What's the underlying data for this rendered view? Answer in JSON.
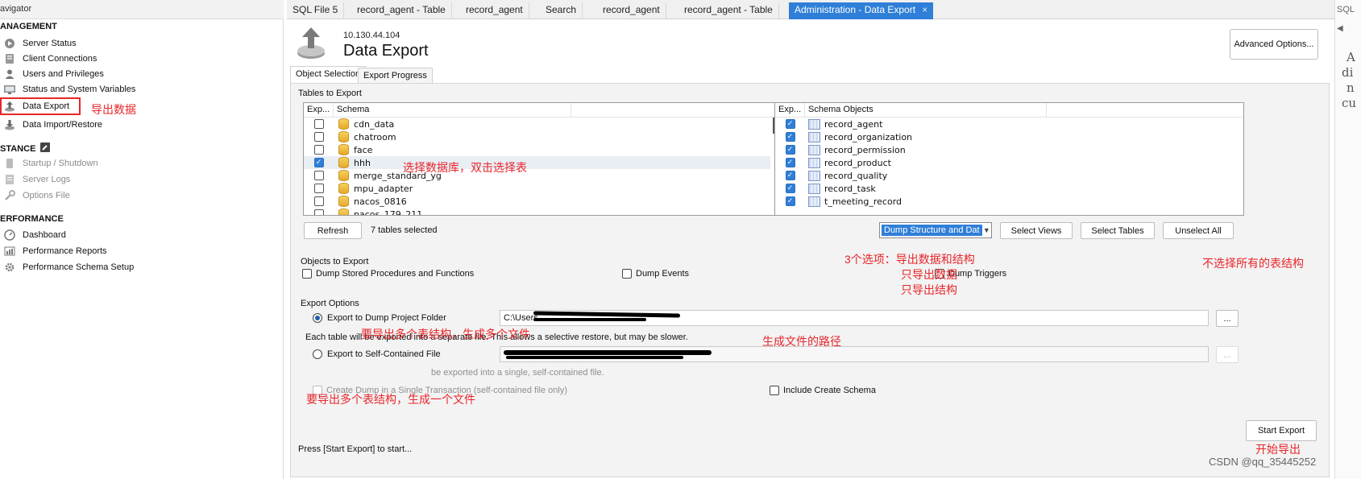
{
  "navigator": {
    "title": "avigator",
    "management": {
      "heading": "ANAGEMENT",
      "items": [
        {
          "label": "Server Status"
        },
        {
          "label": "Client Connections"
        },
        {
          "label": "Users and Privileges"
        },
        {
          "label": "Status and System Variables"
        },
        {
          "label": "Data Export"
        },
        {
          "label": "Data Import/Restore"
        }
      ]
    },
    "instance": {
      "heading": "STANCE",
      "items": [
        {
          "label": "Startup / Shutdown"
        },
        {
          "label": "Server Logs"
        },
        {
          "label": "Options File"
        }
      ]
    },
    "performance": {
      "heading": "ERFORMANCE",
      "items": [
        {
          "label": "Dashboard"
        },
        {
          "label": "Performance Reports"
        },
        {
          "label": "Performance Schema Setup"
        }
      ]
    }
  },
  "tabs": [
    {
      "label": "SQL File 5"
    },
    {
      "label": "record_agent - Table"
    },
    {
      "label": "record_agent"
    },
    {
      "label": "Search"
    },
    {
      "label": "record_agent"
    },
    {
      "label": "record_agent - Table"
    },
    {
      "label": "Administration - Data Export",
      "close": "×"
    }
  ],
  "header": {
    "host": "10.130.44.104",
    "title": "Data Export",
    "advanced_button": "Advanced Options..."
  },
  "subtabs": [
    {
      "label": "Object Selection"
    },
    {
      "label": "Export Progress"
    }
  ],
  "tables_to_export": {
    "group_label": "Tables to Export",
    "schema_list": {
      "col_exp": "Exp...",
      "col_schema": "Schema",
      "rows": [
        {
          "name": "cdn_data",
          "checked": false
        },
        {
          "name": "chatroom",
          "checked": false
        },
        {
          "name": "face",
          "checked": false
        },
        {
          "name": "hhh",
          "checked": true
        },
        {
          "name": "merge_standard_yg",
          "checked": false
        },
        {
          "name": "mpu_adapter",
          "checked": false
        },
        {
          "name": "nacos_0816",
          "checked": false
        },
        {
          "name": "nacos_179_211",
          "checked": false
        }
      ]
    },
    "objects_list": {
      "col_exp": "Exp...",
      "col_objects": "Schema Objects",
      "rows": [
        {
          "name": "record_agent",
          "checked": true
        },
        {
          "name": "record_organization",
          "checked": true
        },
        {
          "name": "record_permission",
          "checked": true
        },
        {
          "name": "record_product",
          "checked": true
        },
        {
          "name": "record_quality",
          "checked": true
        },
        {
          "name": "record_task",
          "checked": true
        },
        {
          "name": "t_meeting_record",
          "checked": true
        }
      ]
    },
    "refresh_button": "Refresh",
    "selected_count": "7 tables selected",
    "dump_mode": "Dump Structure and Dat",
    "select_views_button": "Select Views",
    "select_tables_button": "Select Tables",
    "unselect_all_button": "Unselect All"
  },
  "objects_to_export": {
    "group_label": "Objects to Export",
    "dump_routines": "Dump Stored Procedures and Functions",
    "dump_events": "Dump Events",
    "dump_triggers": "Dump Triggers"
  },
  "export_options": {
    "group_label": "Export Options",
    "folder_option": "Export to Dump Project Folder",
    "folder_path": "C:\\Users",
    "browse": "...",
    "folder_desc": "Each table will be exported into a separate file. This allows a selective restore, but may be slower.",
    "file_option": "Export to Self-Contained File",
    "file_desc_visible": "be exported into a single, self-contained file.",
    "single_transaction": "Create Dump in a Single Transaction (self-contained file only)",
    "include_schema": "Include Create Schema"
  },
  "status_text": "Press [Start Export] to start...",
  "start_button": "Start Export",
  "annotations": {
    "data_export": "导出数据",
    "select_db": "选择数据库，双击选择表",
    "three_options_1": "3个选项：导出数据和结构",
    "three_options_2": "只导出数据",
    "three_options_3": "只导出结构",
    "unselect_all": "不选择所有的表结构",
    "multi_files": "要导出多个表结构，生成多个文件",
    "file_path": "生成文件的路径",
    "one_file": "要导出多个表结构，生成一个文件",
    "start_export": "开始导出"
  },
  "watermark": "CSDN @qq_35445252",
  "right_strip": {
    "tab": "SQL",
    "arrow": "◀",
    "t1": "A",
    "t2": "di",
    "t3": "n",
    "t4": "cu"
  },
  "colors": {
    "accent": "#2f7fd8",
    "annotation": "#e8262a"
  }
}
